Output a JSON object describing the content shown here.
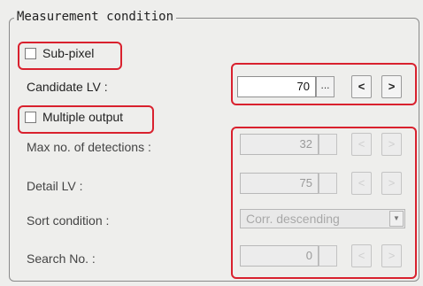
{
  "group": {
    "title": "Measurement condition"
  },
  "subpixel": {
    "label": "Sub-pixel",
    "checked": false
  },
  "candidate_lv": {
    "label": "Candidate LV :",
    "value": "70",
    "dots": "...",
    "prev": "<",
    "next": ">"
  },
  "multiple_output": {
    "label": "Multiple output",
    "checked": false
  },
  "max_detections": {
    "label": "Max no. of detections :",
    "value": "32",
    "prev": "<",
    "next": ">"
  },
  "detail_lv": {
    "label": "Detail LV :",
    "value": "75",
    "prev": "<",
    "next": ">"
  },
  "sort_condition": {
    "label": "Sort condition :",
    "value": "Corr. descending",
    "arrow_icon": "chevron-down-icon"
  },
  "search_no": {
    "label": "Search No. :",
    "value": "0",
    "prev": "<",
    "next": ">"
  },
  "colors": {
    "highlight": "#d9212e",
    "background": "#eeeeec",
    "disabled_text": "#a8a8a8"
  }
}
